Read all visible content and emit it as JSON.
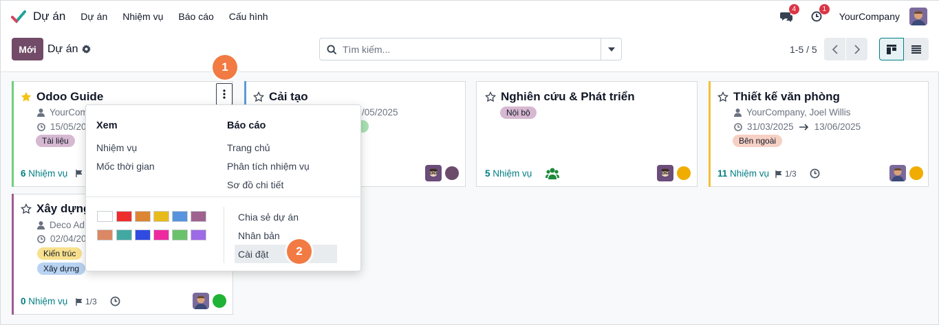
{
  "navbar": {
    "app_name": "Dự án",
    "menu": [
      "Dự án",
      "Nhiệm vụ",
      "Báo cáo",
      "Cấu hình"
    ],
    "messages_badge": "4",
    "activities_badge": "1",
    "company": "YourCompany"
  },
  "control": {
    "new_button": "Mới",
    "breadcrumb": "Dự án",
    "search_placeholder": "Tìm kiếm...",
    "pager": "1-5 / 5"
  },
  "cards": [
    {
      "title": "Odoo Guide",
      "favorite": true,
      "customer": "YourCom",
      "date": "15/05/20",
      "tags": [
        {
          "label": "Tài liệu",
          "color": "#d6b8d1"
        }
      ],
      "tasks_count": "6",
      "tasks_label": "Nhiệm vụ",
      "accent": "#6ed07b"
    },
    {
      "title": "Cải tạo",
      "favorite": false,
      "date_end": "/05/2025",
      "accent": "#5b9bd5"
    },
    {
      "title": "Nghiên cứu & Phát triển",
      "favorite": false,
      "tags": [
        {
          "label": "Nội bộ",
          "color": "#d6b8d1"
        }
      ],
      "tasks_count": "5",
      "tasks_label": "Nhiệm vụ"
    },
    {
      "title": "Thiết kế văn phòng",
      "favorite": false,
      "customer": "YourCompany, Joel Willis",
      "date_start": "31/03/2025",
      "date_end": "13/06/2025",
      "tags": [
        {
          "label": "Bên ngoài",
          "color": "#f6d0c4"
        }
      ],
      "tasks_count": "11",
      "tasks_label": "Nhiệm vụ",
      "milestones": "1/3",
      "accent": "#f2c037"
    },
    {
      "title": "Xây dựng",
      "favorite": false,
      "customer": "Deco Ad",
      "date": "02/04/20",
      "tags": [
        {
          "label": "Kiến trúc",
          "color": "#f8e08e"
        },
        {
          "label": "Xây dựng",
          "color": "#b9d3f2"
        }
      ],
      "tasks_count": "0",
      "tasks_label": "Nhiệm vụ",
      "milestones": "1/3",
      "accent": "#a05c92"
    }
  ],
  "dropdown": {
    "view_header": "Xem",
    "view_items": [
      "Nhiệm vụ",
      "Mốc thời gian"
    ],
    "report_header": "Báo cáo",
    "report_items": [
      "Trang chủ",
      "Phân tích nhiệm vụ",
      "Sơ đồ chi tiết"
    ],
    "actions": [
      "Chia sẻ dự án",
      "Nhân bản",
      "Cài đặt"
    ],
    "colors": [
      "#ffffff",
      "#ee2d2d",
      "#dc8534",
      "#e8bb1d",
      "#5794dd",
      "#9f628f",
      "#db8865",
      "#41a9a2",
      "#304be0",
      "#ee299f",
      "#6ac26a",
      "#9e6be6"
    ]
  },
  "callouts": [
    "1",
    "2"
  ]
}
